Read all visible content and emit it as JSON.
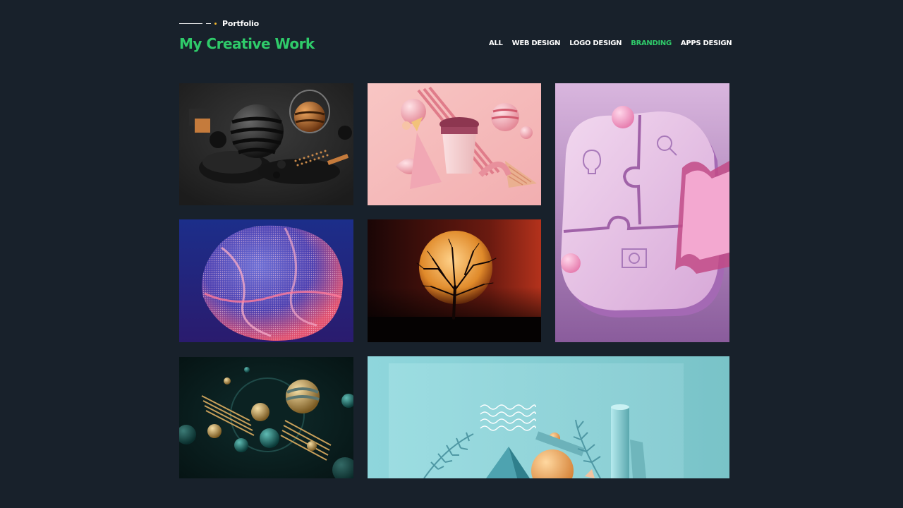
{
  "header": {
    "eyebrow": "Portfolio",
    "title": "My Creative Work"
  },
  "filters": [
    {
      "label": "ALL",
      "active": false
    },
    {
      "label": "WEB DESIGN",
      "active": false
    },
    {
      "label": "LOGO DESIGN",
      "active": false
    },
    {
      "label": "BRANDING",
      "active": true
    },
    {
      "label": "APPS DESIGN",
      "active": false
    }
  ],
  "colors": {
    "background": "#18212b",
    "accent": "#2fcb6a",
    "eyebrow_dot": "#f5b82e"
  },
  "gallery": [
    {
      "name": "dark-3d-spheres-image"
    },
    {
      "name": "pink-coffee-cup-3d-image"
    },
    {
      "name": "purple-puzzle-pieces-image"
    },
    {
      "name": "mesh-sphere-wave-image"
    },
    {
      "name": "moon-tree-silhouette-image"
    },
    {
      "name": "teal-gold-spheres-image"
    },
    {
      "name": "aqua-geometric-palm-image"
    }
  ]
}
